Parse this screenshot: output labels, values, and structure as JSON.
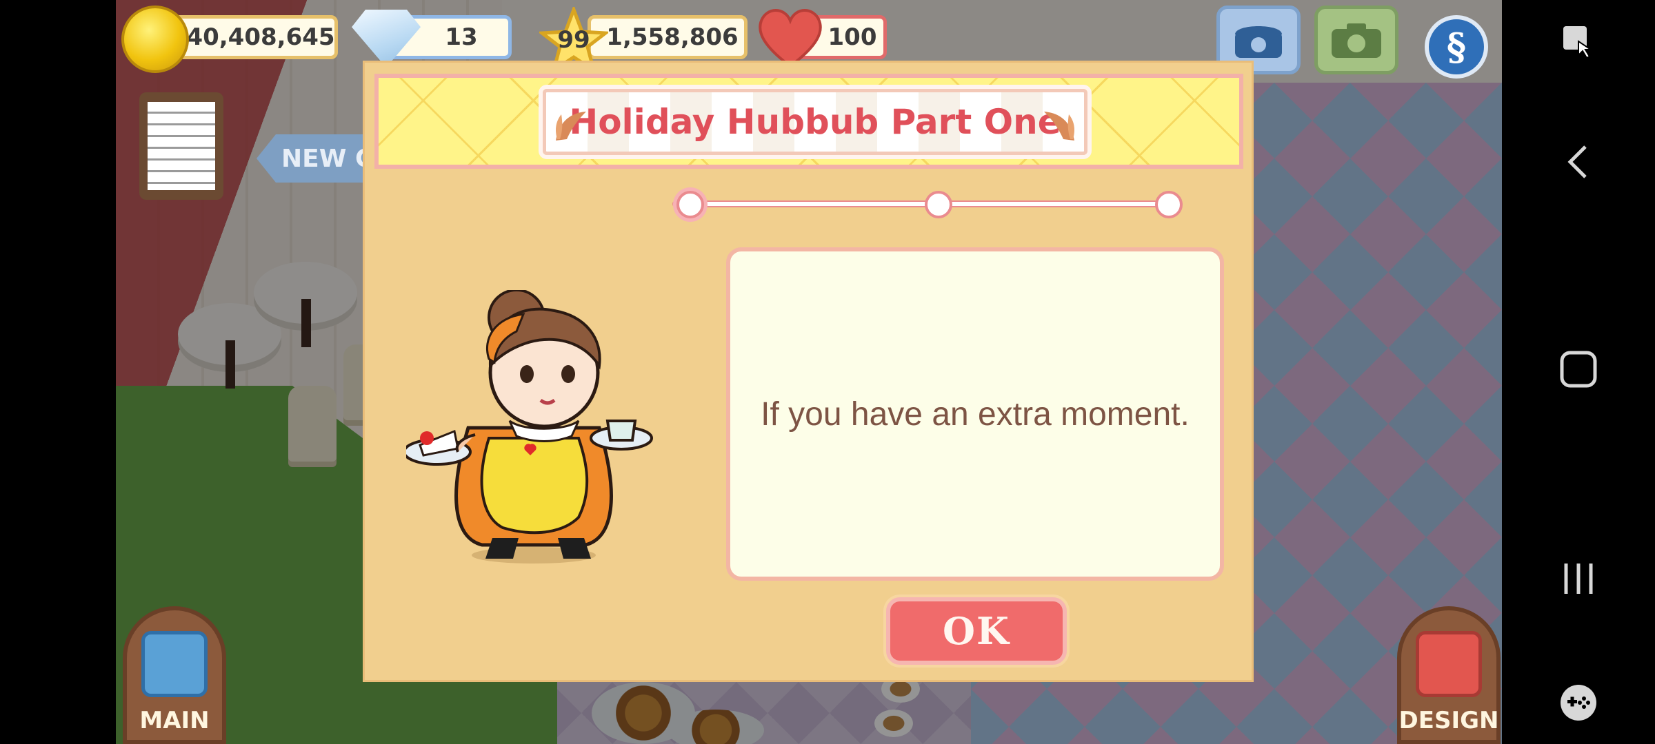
{
  "hud": {
    "coins": "40,408,645",
    "gems": "13",
    "level": "99",
    "experience": "1,558,806",
    "hearts": "100"
  },
  "scene": {
    "new_sign": "NEW G"
  },
  "dialog": {
    "title": "Holiday Hubbub Part One",
    "message": "If you have an extra moment.",
    "ok_label": "OK",
    "progress": {
      "steps": 3,
      "current": 1
    }
  },
  "bottom_buttons": {
    "main_label": "MAIN",
    "design_label": "DESIGN"
  },
  "colors": {
    "title_red": "#e0505a",
    "ok_red": "#f06b6b",
    "dialog_bg": "#f1cf8e",
    "message_text": "#7d5444"
  },
  "icons": [
    "coin-icon",
    "gem-icon",
    "star-icon",
    "heart-icon",
    "phone-icon",
    "camera-icon",
    "currency-s-icon",
    "clipboard-icon",
    "screenshot-icon",
    "back-icon",
    "home-icon",
    "recents-icon",
    "game-tools-icon"
  ]
}
